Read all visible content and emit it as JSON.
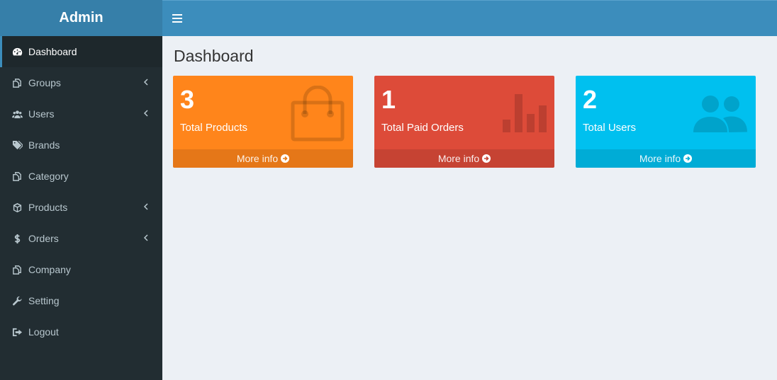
{
  "header": {
    "brand": "Admin",
    "toggle_icon": "hamburger-menu-icon"
  },
  "sidebar": {
    "items": [
      {
        "label": "Dashboard",
        "icon": "dashboard-icon",
        "active": true
      },
      {
        "label": "Groups",
        "icon": "copy-icon",
        "has_submenu": true
      },
      {
        "label": "Users",
        "icon": "users-icon",
        "has_submenu": true
      },
      {
        "label": "Brands",
        "icon": "tags-icon"
      },
      {
        "label": "Category",
        "icon": "copy-icon"
      },
      {
        "label": "Products",
        "icon": "cube-icon",
        "has_submenu": true
      },
      {
        "label": "Orders",
        "icon": "dollar-icon",
        "has_submenu": true
      },
      {
        "label": "Company",
        "icon": "copy-icon"
      },
      {
        "label": "Setting",
        "icon": "wrench-icon"
      },
      {
        "label": "Logout",
        "icon": "sign-out-icon"
      }
    ]
  },
  "main": {
    "title": "Dashboard",
    "boxes": [
      {
        "count": "3",
        "title": "Total Products",
        "more": "More info",
        "color": "#ff851b",
        "icon": "shopping-bag-icon"
      },
      {
        "count": "1",
        "title": "Total Paid Orders",
        "more": "More info",
        "color": "#dd4b39",
        "icon": "bar-chart-icon"
      },
      {
        "count": "2",
        "title": "Total Users",
        "more": "More info",
        "color": "#00c0ef",
        "icon": "users-icon"
      }
    ]
  },
  "colors": {
    "sidebar": "#222d32",
    "header": "#3c8dbc",
    "logo": "#367fa9",
    "content": "#ecf0f5"
  }
}
